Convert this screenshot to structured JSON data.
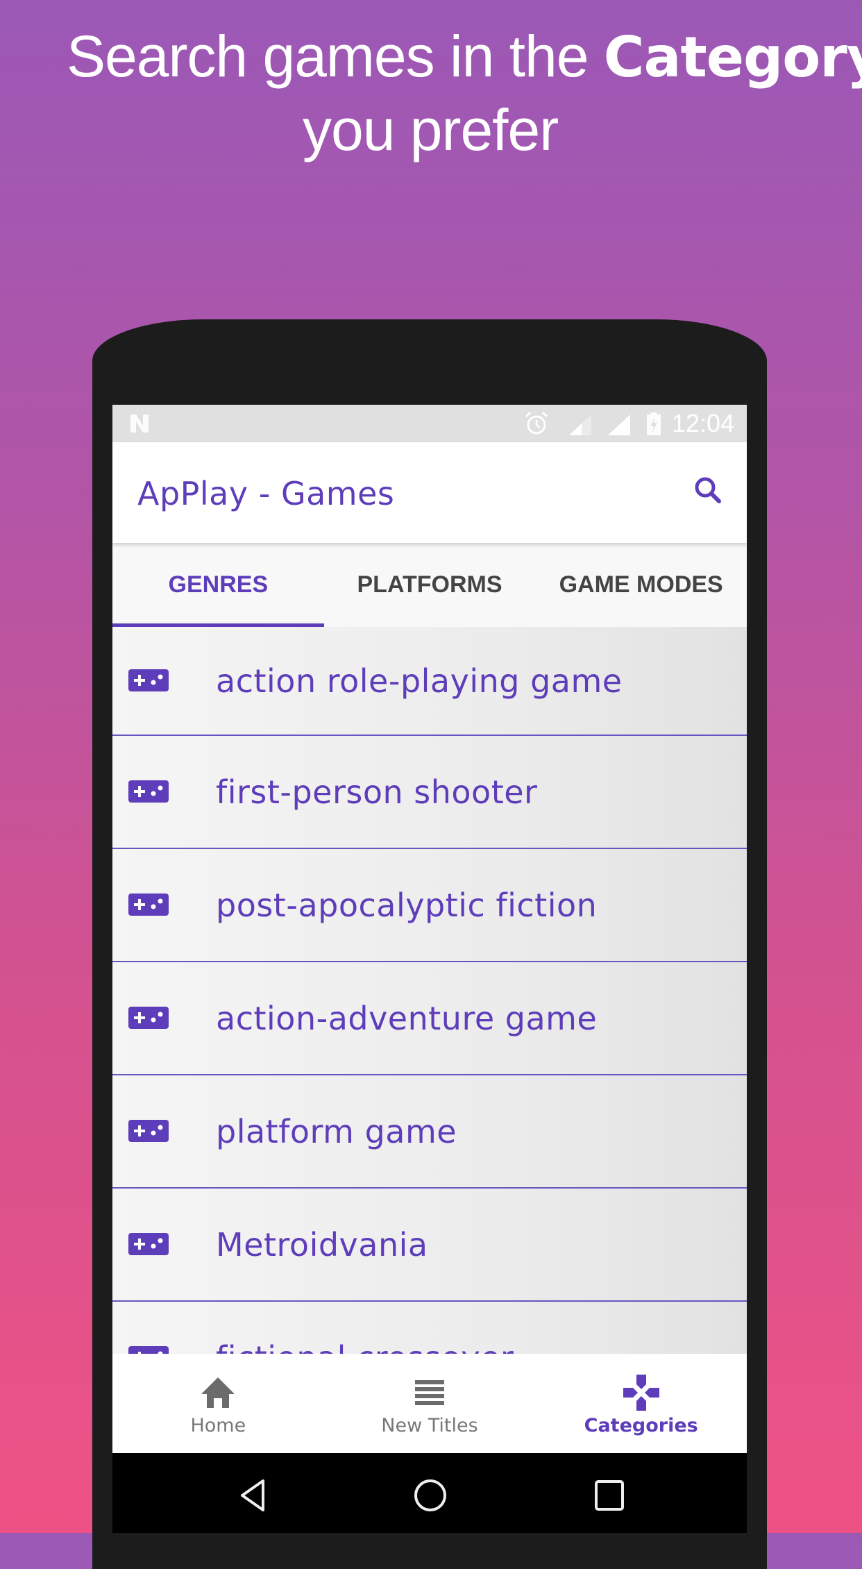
{
  "headline": {
    "line1_prefix": "Search games in the ",
    "line1_emphasis": "Category",
    "line2": "you prefer"
  },
  "status_bar": {
    "time": "12:04",
    "icons": [
      "notification-n-icon",
      "alarm-icon",
      "signal-icon",
      "signal-icon",
      "battery-charging-icon"
    ]
  },
  "app_bar": {
    "title": "ApPlay - Games",
    "search_icon": "search-icon"
  },
  "tabs": [
    {
      "label": "GENRES",
      "active": true
    },
    {
      "label": "PLATFORMS",
      "active": false
    },
    {
      "label": "GAME MODES",
      "active": false
    }
  ],
  "genres": [
    {
      "label": "action role-playing game",
      "icon": "gamepad-icon"
    },
    {
      "label": "first-person shooter",
      "icon": "gamepad-icon"
    },
    {
      "label": "post-apocalyptic fiction",
      "icon": "gamepad-icon"
    },
    {
      "label": "action-adventure game",
      "icon": "gamepad-icon"
    },
    {
      "label": "platform game",
      "icon": "gamepad-icon"
    },
    {
      "label": "Metroidvania",
      "icon": "gamepad-icon"
    },
    {
      "label": "fictional crossover",
      "icon": "gamepad-icon"
    }
  ],
  "bottom_nav": [
    {
      "label": "Home",
      "icon": "home-icon",
      "active": false
    },
    {
      "label": "New Titles",
      "icon": "list-icon",
      "active": false
    },
    {
      "label": "Categories",
      "icon": "dpad-icon",
      "active": true
    }
  ],
  "system_nav": [
    "back-icon",
    "home-circle-icon",
    "recents-icon"
  ],
  "colors": {
    "accent": "#5e3dba",
    "background_top": "#9b59b6",
    "background_bottom": "#ee5285",
    "phone_body": "#1c1c1c",
    "status_bar": "#e0e0e0",
    "inactive_text": "#444444"
  }
}
